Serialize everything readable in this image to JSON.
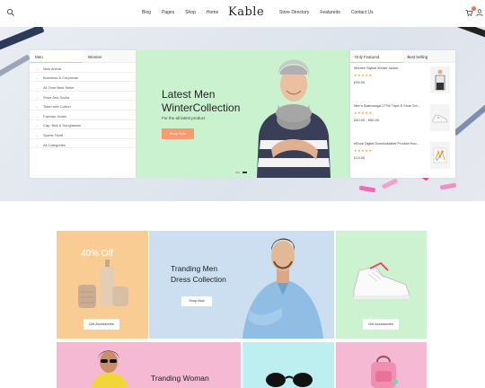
{
  "header": {
    "logo": "Kable",
    "nav_left": [
      "Blog",
      "Pages",
      "Shop",
      "Home"
    ],
    "nav_right": [
      "Store Directory",
      "Featureds",
      "Contact Us"
    ],
    "cart_count": "0",
    "icons": [
      "search-icon",
      "user-icon",
      "cart-icon"
    ]
  },
  "categories": {
    "tabs": [
      "Men",
      "Women"
    ],
    "items": [
      "New Arrival",
      "Business & Corporate",
      "All Time Best Seller",
      "Shoe And Socks",
      "Tshirt with Cotton",
      "Fashion Jeans",
      "Cap, Belt & Sunglasses",
      "Sports Tshirt",
      "All Categories"
    ]
  },
  "slider": {
    "title_line1": "Latest Men",
    "title_line2": "WinterCollection",
    "subtitle": "For the all latest product",
    "button": "Shop Now",
    "bg_color": "#cbf2cf"
  },
  "products": {
    "tabs": [
      "Only Featured",
      "Best Selling"
    ],
    "items": [
      {
        "name": "Women Stylish Winter Jacket",
        "stars": "★★★★★",
        "price": "£55.00"
      },
      {
        "name": "Men's Balenciaga 177W Tripe-S Shoe Sm…",
        "stars": "★★★★★",
        "price": "£40.00 - £60.00"
      },
      {
        "name": "eBook Digital Downloadable Product Hoo…",
        "stars": "★★★★★",
        "price": "£14.00"
      }
    ]
  },
  "banners": {
    "off_text": "40% Off",
    "accessories_button": "Get Accessories",
    "dress_title_line1": "Tranding Men",
    "dress_title_line2": "Dress Collection",
    "shop_now": "Shop Now",
    "shoe_button": "Get Accessories",
    "woman_title": "Tranding Woman",
    "colors": {
      "orange": "#f9cc93",
      "blue": "#cbdff1",
      "green": "#cdf2d0",
      "pink": "#f6b9d3",
      "cyan": "#bdeef0"
    }
  }
}
